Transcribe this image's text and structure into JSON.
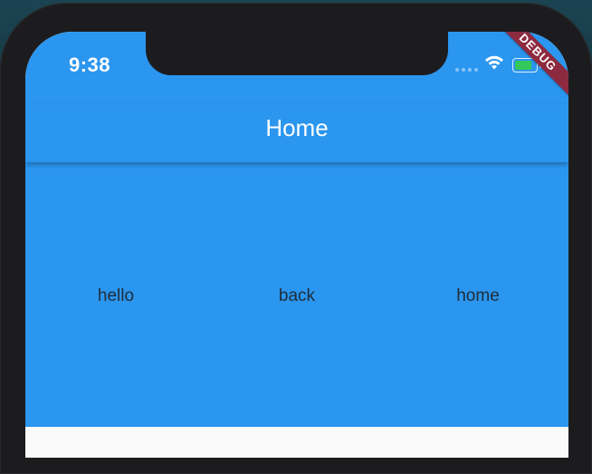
{
  "status_bar": {
    "time": "9:38",
    "icons": [
      "cellular-signal-icon",
      "wifi-icon",
      "battery-charging-icon"
    ],
    "battery_color": "#34c759"
  },
  "app_bar": {
    "title": "Home",
    "color": "#2b96ef"
  },
  "body": {
    "items": [
      {
        "label": "hello"
      },
      {
        "label": "back"
      },
      {
        "label": "home"
      }
    ]
  },
  "debug_banner": {
    "label": "DEBUG",
    "color": "#8e2a3f"
  }
}
